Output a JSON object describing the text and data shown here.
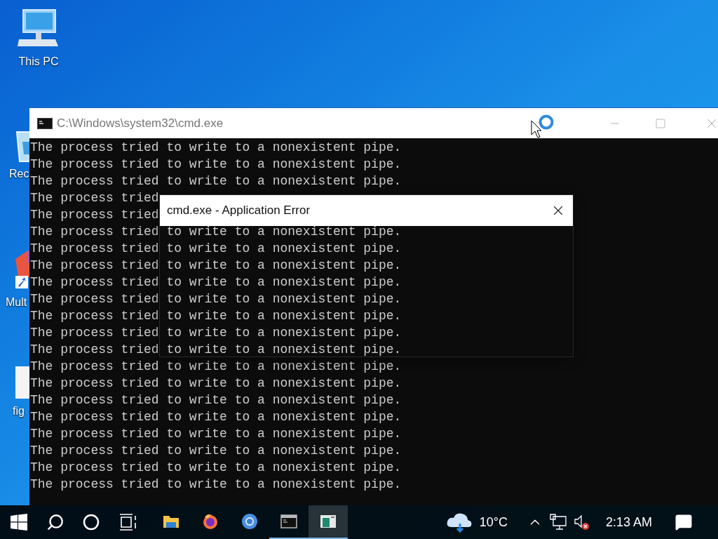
{
  "desktop_icons": [
    {
      "kind": "computer",
      "label": "This PC"
    },
    {
      "kind": "bin",
      "label": "Rec"
    },
    {
      "kind": "app",
      "label": "Mult"
    },
    {
      "kind": "file",
      "label": "fig"
    }
  ],
  "console_window": {
    "title": "C:\\Windows\\system32\\cmd.exe",
    "lines": [
      "The process tried to write to a nonexistent pipe.",
      "The process tried to write to a nonexistent pipe.",
      "The process tried to write to a nonexistent pipe.",
      "The process tried",
      "The process tried",
      "The process tried to write to a nonexistent pipe.",
      "The process tried to write to a nonexistent pipe.",
      "The process tried to write to a nonexistent pipe.",
      "The process tried to write to a nonexistent pipe.",
      "The process tried to write to a nonexistent pipe.",
      "The process tried to write to a nonexistent pipe.",
      "The process tried to write to a nonexistent pipe.",
      "The process tried to write to a nonexistent pipe.",
      "The process tried to write to a nonexistent pipe.",
      "The process tried to write to a nonexistent pipe.",
      "The process tried to write to a nonexistent pipe.",
      "The process tried to write to a nonexistent pipe.",
      "The process tried to write to a nonexistent pipe.",
      "The process tried to write to a nonexistent pipe.",
      "The process tried to write to a nonexistent pipe.",
      "The process tried to write to a nonexistent pipe."
    ]
  },
  "dialog": {
    "title": "cmd.exe - Application Error"
  },
  "taskbar": {
    "apps": [
      {
        "kind": "explorer",
        "running": false,
        "selected": false
      },
      {
        "kind": "firefox",
        "running": false,
        "selected": false
      },
      {
        "kind": "chrome",
        "running": false,
        "selected": false
      },
      {
        "kind": "console",
        "running": true,
        "selected": false
      },
      {
        "kind": "dialog",
        "running": true,
        "selected": true
      }
    ],
    "temperature": "10°C",
    "time": "2:13 AM"
  }
}
